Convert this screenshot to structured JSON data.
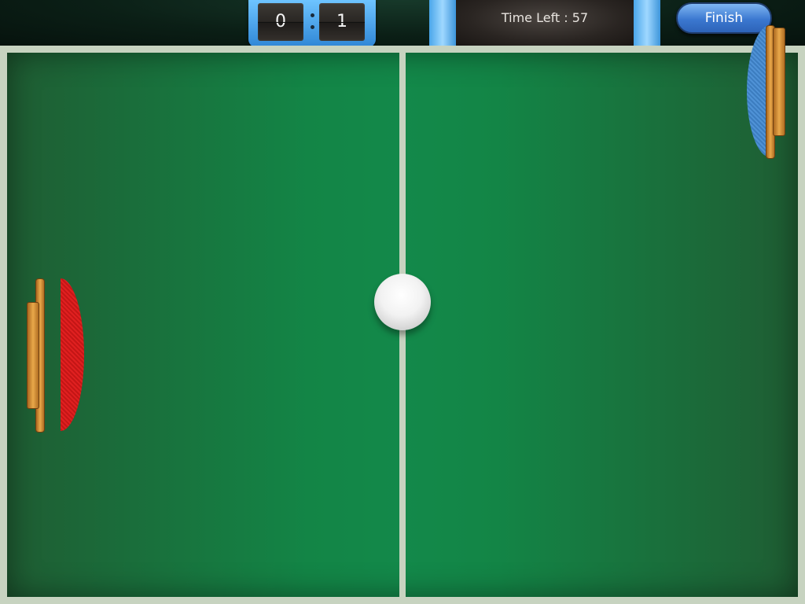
{
  "scoreboard": {
    "player_score": "0",
    "opponent_score": "1"
  },
  "timer": {
    "label": "Time Left : 57"
  },
  "buttons": {
    "finish_label": "Finish"
  },
  "colors": {
    "table_green": "#138546",
    "table_line": "#c7d3c0",
    "player_paddle": "#e02020",
    "opponent_paddle": "#4f92d6",
    "hud_accent": "#6ec4ff",
    "finish_button": "#3b78d0"
  },
  "icons": {
    "ball": "ping-pong-ball",
    "player_paddle": "red-paddle",
    "opponent_paddle": "blue-paddle"
  }
}
